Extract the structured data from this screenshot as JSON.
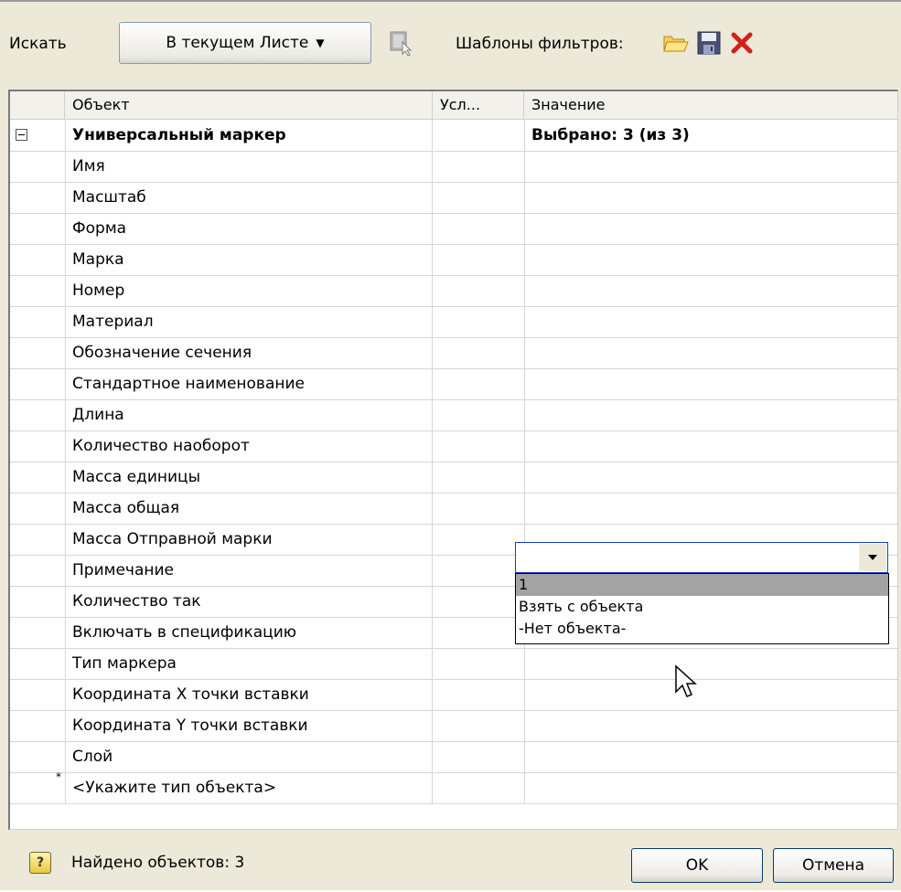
{
  "toolbar": {
    "search_label": "Искать",
    "scope_button": "В текущем Листе",
    "scope_arrow": "▼",
    "templates_label": "Шаблоны фильтров:"
  },
  "grid": {
    "columns": [
      "Объект",
      "Усл...",
      "Значение"
    ],
    "group_row": {
      "object": "Универсальный маркер",
      "value": "Выбрано: 3 (из 3)"
    },
    "rows": [
      "Имя",
      "Масштаб",
      "Форма",
      "Марка",
      "Номер",
      "Материал",
      "Обозначение сечения",
      "Стандартное наименование",
      "Длина",
      "Количество наоборот",
      "Масса единицы",
      "Масса общая",
      "Масса Отправной марки",
      "Примечание",
      "Количество так",
      "Включать в спецификацию",
      "Тип маркера",
      "Координата X точки вставки",
      "Координата Y точки вставки",
      "Слой"
    ],
    "new_row_marker": "*",
    "new_row_placeholder": "<Укажите тип объекта>"
  },
  "dropdown": {
    "value": "",
    "options": [
      "1",
      "Взять с объекта",
      "-Нет объекта-"
    ],
    "selected_index": 0
  },
  "status": {
    "help_glyph": "?",
    "found_text": "Найдено объектов: 3",
    "ok_label": "OK",
    "cancel_label": "Отмена"
  },
  "colors": {
    "window_bg": "#ece9d8",
    "combo_border": "#1c3ccf",
    "option_selected": "#a3a3a3",
    "delete_red": "#d4201a"
  }
}
